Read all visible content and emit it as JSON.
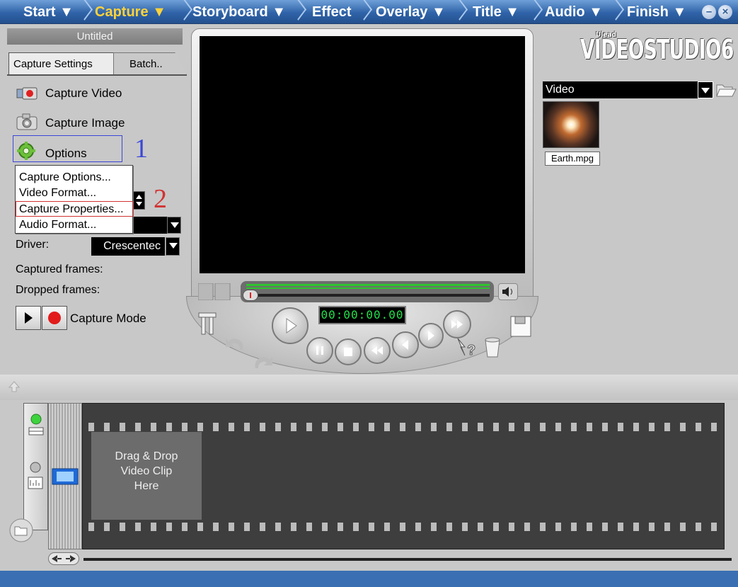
{
  "nav": {
    "tabs": [
      {
        "label": "Start ▼",
        "active": false
      },
      {
        "label": "Capture ▼",
        "active": true
      },
      {
        "label": "Storyboard ▼",
        "active": false
      },
      {
        "label": "Effect",
        "active": false
      },
      {
        "label": "Overlay ▼",
        "active": false
      },
      {
        "label": "Title ▼",
        "active": false
      },
      {
        "label": "Audio ▼",
        "active": false
      },
      {
        "label": "Finish ▼",
        "active": false
      }
    ],
    "minimize": "–",
    "close": "×"
  },
  "project": {
    "title": "Untitled"
  },
  "capture_panel": {
    "tabs": [
      "Capture Settings",
      "Batch.."
    ],
    "items": [
      {
        "label": "Capture Video",
        "icon": "camcorder-icon"
      },
      {
        "label": "Capture Image",
        "icon": "camera-icon"
      },
      {
        "label": "Options",
        "icon": "gear-icon"
      }
    ],
    "driver_label": "Driver:",
    "driver_value": "Crescentec",
    "captured_frames_label": "Captured frames:",
    "dropped_frames_label": "Dropped frames:",
    "capture_mode_label": "Capture Mode"
  },
  "options_menu": {
    "items": [
      "Capture Options...",
      "Video Format...",
      "Capture Properties...",
      "Audio Format..."
    ],
    "highlighted_index": 2
  },
  "annotations": {
    "step1": "1",
    "step2": "2"
  },
  "player": {
    "timecode": "00:00:00.00"
  },
  "library": {
    "logo_small": "Ulead",
    "logo": "VIDEOSTUDIO6",
    "category": "Video",
    "clips": [
      {
        "name": "Earth.mpg"
      }
    ]
  },
  "timeline": {
    "drop_hint": "Drag & Drop\nVideo Clip\nHere"
  },
  "colors": {
    "nav_active": "#ffd23a",
    "nav_bg": "#2f63a8",
    "annotation_blue": "#3b47d6",
    "annotation_red": "#d23232",
    "timecode": "#23e04b"
  }
}
